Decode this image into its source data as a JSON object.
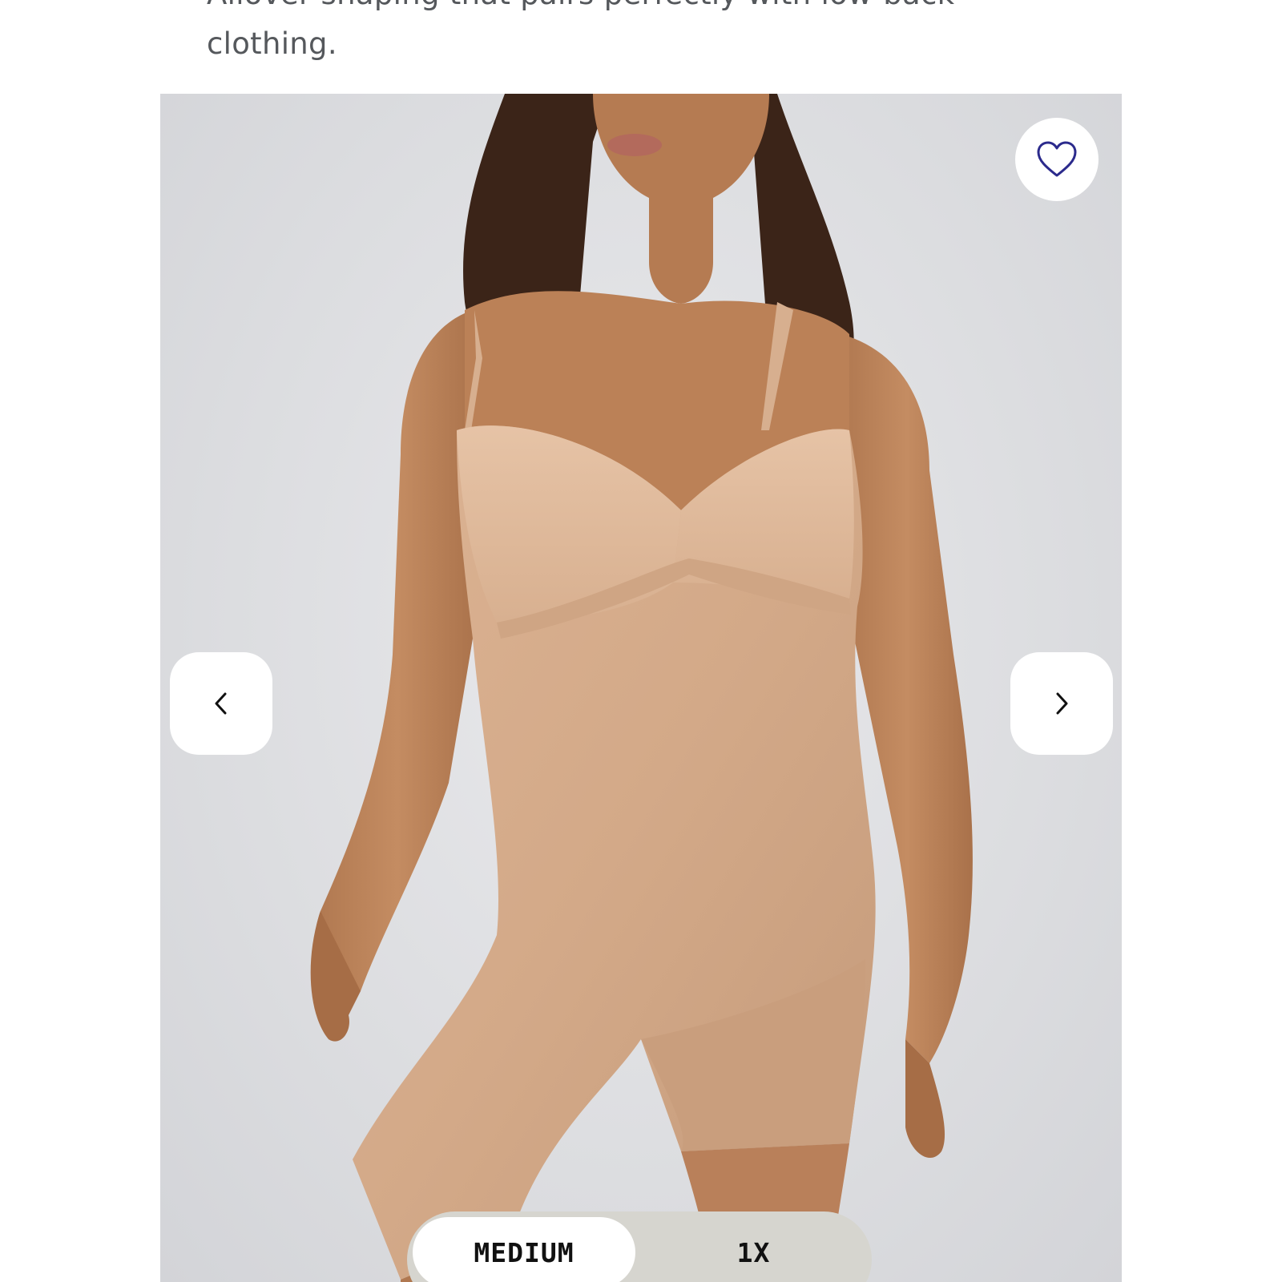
{
  "product": {
    "description": "Allover shaping that pairs perfectly with low-back clothing."
  },
  "gallery": {
    "favorite_icon": "heart-outline-icon",
    "prev_icon": "chevron-left-icon",
    "next_icon": "chevron-right-icon",
    "accent_color": "#2b2a8c"
  },
  "size_selector": {
    "options": [
      "MEDIUM",
      "1X"
    ],
    "selected": "MEDIUM"
  }
}
